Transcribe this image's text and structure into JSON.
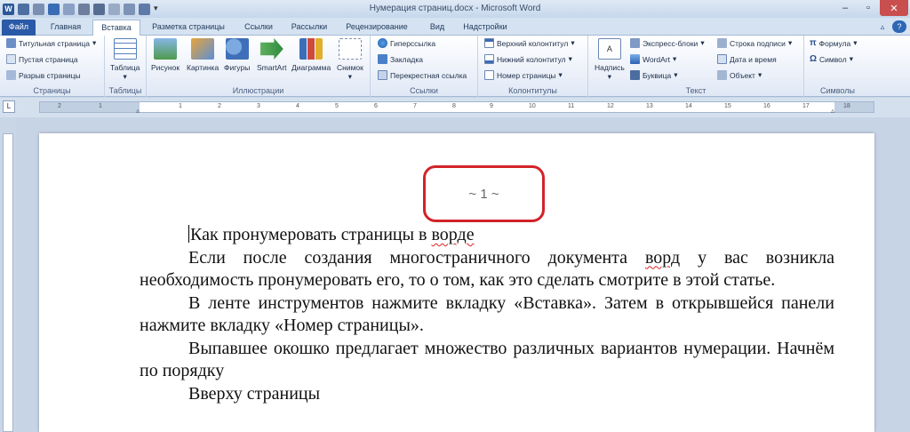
{
  "window": {
    "title": "Нумерация страниц.docx - Microsoft Word",
    "logo_letter": "W"
  },
  "tabs": [
    "Файл",
    "Главная",
    "Вставка",
    "Разметка страницы",
    "Ссылки",
    "Рассылки",
    "Рецензирование",
    "Вид",
    "Надстройки"
  ],
  "ribbon": {
    "pages": {
      "items": [
        "Титульная страница",
        "Пустая страница",
        "Разрыв страницы"
      ],
      "label": "Страницы"
    },
    "tables": {
      "button": "Таблица",
      "label": "Таблицы"
    },
    "illustrations": {
      "buttons": [
        "Рисунок",
        "Картинка",
        "Фигуры",
        "SmartArt",
        "Диаграмма",
        "Снимок"
      ],
      "label": "Иллюстрации"
    },
    "links": {
      "items": [
        "Гиперссылка",
        "Закладка",
        "Перекрестная ссылка"
      ],
      "label": "Ссылки"
    },
    "header_footer": {
      "items": [
        "Верхний колонтитул",
        "Нижний колонтитул",
        "Номер страницы"
      ],
      "label": "Колонтитулы"
    },
    "text": {
      "big_button": "Надпись",
      "col1": [
        "Экспресс-блоки",
        "WordArt",
        "Буквица"
      ],
      "col2": [
        "Строка подписи",
        "Дата и время",
        "Объект"
      ],
      "label": "Текст"
    },
    "symbols": {
      "items": [
        "Формула",
        "Символ"
      ],
      "label": "Символы"
    }
  },
  "ruler": {
    "numbers": [
      "2",
      "1",
      "1",
      "2",
      "3",
      "4",
      "5",
      "6",
      "7",
      "8",
      "9",
      "10",
      "11",
      "12",
      "13",
      "14",
      "15",
      "16",
      "17",
      "18"
    ]
  },
  "document": {
    "page_number": "~ 1 ~",
    "heading": "Как пронумеровать страницы в ",
    "heading_misspelled": "ворде",
    "p1_start": "Если после создания многостраничного документа ",
    "p1_misspelled": "ворд",
    "p1_end": " у вас возникла необходимость пронумеровать его, то о том, как это сделать смотрите в этой статье.",
    "p2": "В ленте инструментов нажмите вкладку «Вставка». Затем в открывшейся панели нажмите вкладку «Номер страницы».",
    "p3": "Выпавшее окошко предлагает множество различных вариантов нумерации. Начнём по порядку",
    "p4": "Вверху страницы"
  },
  "colors": {
    "accent": "#2a5aa7",
    "highlight_box": "#d2232a"
  }
}
